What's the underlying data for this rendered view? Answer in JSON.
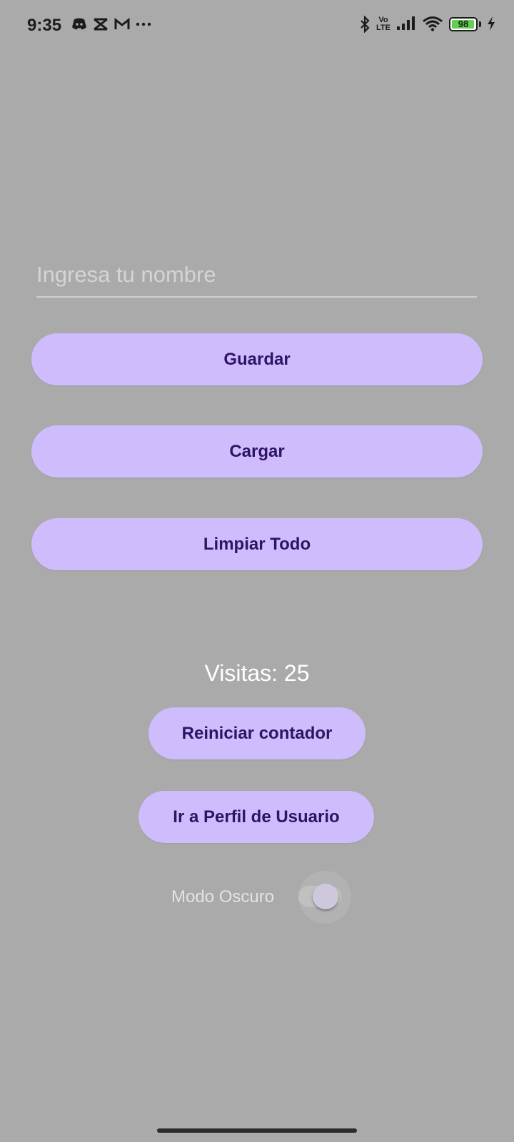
{
  "status_bar": {
    "time": "9:35",
    "left_icons": [
      "discord-icon",
      "capcut-icon",
      "gmail-icon",
      "more-dots-icon"
    ],
    "volte_line1": "Vo",
    "volte_line2": "LTE",
    "battery_level": "98",
    "battery_color": "#5ed14f"
  },
  "form": {
    "name_placeholder": "Ingresa tu nombre",
    "name_value": "",
    "save_label": "Guardar",
    "load_label": "Cargar",
    "clear_label": "Limpiar Todo"
  },
  "counter": {
    "visits_text": "Visitas: 25",
    "reset_label": "Reiniciar contador"
  },
  "profile_button_label": "Ir a Perfil de Usuario",
  "dark_mode": {
    "label": "Modo Oscuro",
    "enabled": false
  },
  "colors": {
    "background": "#aaaaaa",
    "button_bg": "#cfbcfd",
    "button_text": "#2e1465"
  }
}
